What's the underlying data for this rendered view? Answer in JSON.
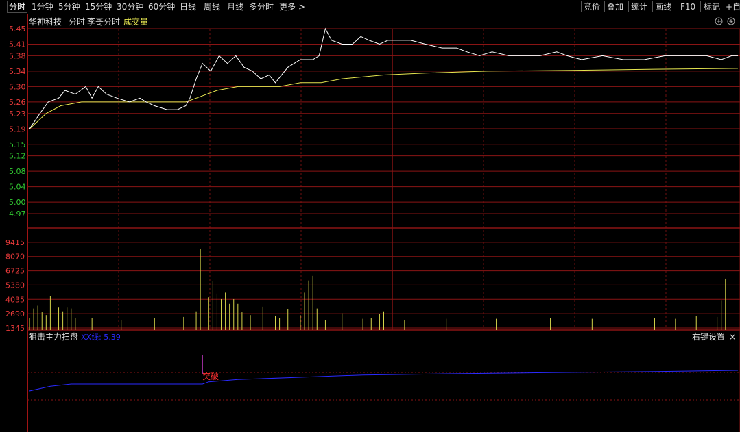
{
  "toolbar": {
    "tabs": [
      {
        "label": "分时",
        "active": true
      },
      {
        "label": "1分钟",
        "active": false
      },
      {
        "label": "5分钟",
        "active": false
      },
      {
        "label": "15分钟",
        "active": false
      },
      {
        "label": "30分钟",
        "active": false
      },
      {
        "label": "60分钟",
        "active": false
      },
      {
        "label": "日线",
        "active": false
      },
      {
        "label": "周线",
        "active": false
      },
      {
        "label": "月线",
        "active": false
      },
      {
        "label": "多分时",
        "active": false
      },
      {
        "label": "更多 >",
        "active": false
      }
    ],
    "right_tools": [
      "竞价",
      "叠加",
      "统计",
      "画线",
      "F10",
      "标记",
      "+自选"
    ]
  },
  "header": {
    "stock_name": "华神科技",
    "view_label": "分时",
    "indicator_label": "李哥分时",
    "volume_label": "成交量"
  },
  "sub_panel": {
    "title": "狙击主力扫盘",
    "line_label": "XX线: 5.39",
    "settings_label": "右键设置",
    "close_label": "×",
    "signal_label": "突破"
  },
  "colors": {
    "background": "#000000",
    "grid": "#8a1414",
    "price_up": "#e83a3a",
    "price_down": "#33cc33",
    "price_line": "#ffffff",
    "avg_line": "#e6e650",
    "volume_bar": "#d4d44a",
    "indicator_line": "#2a2aff",
    "signal_marker": "#e040e0",
    "signal_text": "#ff3030"
  },
  "chart_data": {
    "type": "line",
    "title": "",
    "price_axis_ticks": [
      5.45,
      5.41,
      5.38,
      5.34,
      5.3,
      5.26,
      5.23,
      5.19,
      5.15,
      5.12,
      5.08,
      5.04,
      5.0,
      4.97
    ],
    "prev_close": 5.19,
    "volume_axis_ticks": [
      9415,
      8070,
      6725,
      5380,
      4035,
      2690,
      1345
    ],
    "price_series": {
      "name": "",
      "points": [
        [
          0,
          5.19
        ],
        [
          5,
          5.23
        ],
        [
          9,
          5.26
        ],
        [
          14,
          5.27
        ],
        [
          17,
          5.29
        ],
        [
          22,
          5.28
        ],
        [
          27,
          5.3
        ],
        [
          30,
          5.27
        ],
        [
          33,
          5.3
        ],
        [
          37,
          5.28
        ],
        [
          42,
          5.27
        ],
        [
          48,
          5.26
        ],
        [
          53,
          5.27
        ],
        [
          56,
          5.26
        ],
        [
          60,
          5.25
        ],
        [
          66,
          5.24
        ],
        [
          71,
          5.24
        ],
        [
          75,
          5.25
        ],
        [
          77,
          5.27
        ],
        [
          80,
          5.32
        ],
        [
          83,
          5.36
        ],
        [
          87,
          5.34
        ],
        [
          91,
          5.38
        ],
        [
          95,
          5.36
        ],
        [
          99,
          5.38
        ],
        [
          103,
          5.35
        ],
        [
          107,
          5.34
        ],
        [
          111,
          5.32
        ],
        [
          115,
          5.33
        ],
        [
          118,
          5.31
        ],
        [
          121,
          5.33
        ],
        [
          124,
          5.35
        ],
        [
          127,
          5.36
        ],
        [
          130,
          5.37
        ],
        [
          133,
          5.37
        ],
        [
          136,
          5.37
        ],
        [
          139,
          5.38
        ],
        [
          142,
          5.45
        ],
        [
          145,
          5.42
        ],
        [
          150,
          5.41
        ],
        [
          155,
          5.41
        ],
        [
          159,
          5.43
        ],
        [
          163,
          5.42
        ],
        [
          168,
          5.41
        ],
        [
          172,
          5.42
        ],
        [
          178,
          5.42
        ],
        [
          183,
          5.42
        ],
        [
          190,
          5.41
        ],
        [
          198,
          5.4
        ],
        [
          205,
          5.4
        ],
        [
          210,
          5.39
        ],
        [
          216,
          5.38
        ],
        [
          222,
          5.39
        ],
        [
          230,
          5.38
        ],
        [
          238,
          5.38
        ],
        [
          245,
          5.38
        ],
        [
          253,
          5.39
        ],
        [
          258,
          5.38
        ],
        [
          265,
          5.37
        ],
        [
          275,
          5.38
        ],
        [
          285,
          5.37
        ],
        [
          295,
          5.37
        ],
        [
          305,
          5.38
        ],
        [
          315,
          5.38
        ],
        [
          325,
          5.38
        ],
        [
          332,
          5.37
        ],
        [
          337,
          5.38
        ],
        [
          340,
          5.38
        ]
      ]
    },
    "avg_series": {
      "name": "",
      "points": [
        [
          0,
          5.19
        ],
        [
          8,
          5.23
        ],
        [
          15,
          5.25
        ],
        [
          25,
          5.26
        ],
        [
          40,
          5.26
        ],
        [
          60,
          5.26
        ],
        [
          75,
          5.26
        ],
        [
          80,
          5.27
        ],
        [
          90,
          5.29
        ],
        [
          100,
          5.3
        ],
        [
          120,
          5.3
        ],
        [
          130,
          5.31
        ],
        [
          140,
          5.31
        ],
        [
          150,
          5.32
        ],
        [
          170,
          5.33
        ],
        [
          190,
          5.335
        ],
        [
          220,
          5.34
        ],
        [
          260,
          5.342
        ],
        [
          300,
          5.345
        ],
        [
          340,
          5.347
        ]
      ]
    },
    "volume_series": {
      "name": "",
      "points": [
        [
          0,
          1300
        ],
        [
          2,
          2300
        ],
        [
          3,
          1600
        ],
        [
          5,
          2600
        ],
        [
          7,
          1900
        ],
        [
          9,
          1600
        ],
        [
          11,
          3600
        ],
        [
          14,
          2400
        ],
        [
          16,
          2000
        ],
        [
          18,
          2400
        ],
        [
          20,
          2300
        ],
        [
          22,
          1300
        ],
        [
          31,
          1300
        ],
        [
          45,
          1100
        ],
        [
          60,
          1300
        ],
        [
          75,
          1400
        ],
        [
          80,
          2000
        ],
        [
          83,
          8700
        ],
        [
          86,
          3500
        ],
        [
          88,
          5200
        ],
        [
          90,
          3900
        ],
        [
          92,
          3300
        ],
        [
          94,
          4000
        ],
        [
          96,
          2800
        ],
        [
          98,
          3300
        ],
        [
          100,
          2800
        ],
        [
          103,
          1900
        ],
        [
          106,
          1600
        ],
        [
          112,
          2500
        ],
        [
          119,
          1500
        ],
        [
          121,
          1300
        ],
        [
          125,
          2200
        ],
        [
          130,
          1600
        ],
        [
          133,
          4000
        ],
        [
          135,
          5300
        ],
        [
          137,
          5800
        ],
        [
          139,
          2300
        ],
        [
          143,
          1100
        ],
        [
          150,
          1800
        ],
        [
          160,
          1200
        ],
        [
          165,
          1300
        ],
        [
          168,
          1700
        ],
        [
          170,
          2000
        ],
        [
          180,
          1100
        ],
        [
          200,
          1200
        ],
        [
          225,
          1200
        ],
        [
          250,
          1300
        ],
        [
          270,
          1200
        ],
        [
          300,
          1300
        ],
        [
          310,
          1200
        ],
        [
          320,
          1500
        ],
        [
          330,
          1400
        ],
        [
          333,
          3200
        ],
        [
          335,
          5500
        ]
      ]
    },
    "indicator_series": {
      "name": "",
      "points": [
        [
          0,
          5.3
        ],
        [
          10,
          5.32
        ],
        [
          20,
          5.33
        ],
        [
          40,
          5.33
        ],
        [
          70,
          5.33
        ],
        [
          83,
          5.33
        ],
        [
          86,
          5.34
        ],
        [
          100,
          5.35
        ],
        [
          130,
          5.36
        ],
        [
          160,
          5.37
        ],
        [
          200,
          5.375
        ],
        [
          250,
          5.38
        ],
        [
          300,
          5.385
        ],
        [
          340,
          5.39
        ]
      ]
    },
    "signal": {
      "x": 83,
      "label": "突破"
    }
  }
}
